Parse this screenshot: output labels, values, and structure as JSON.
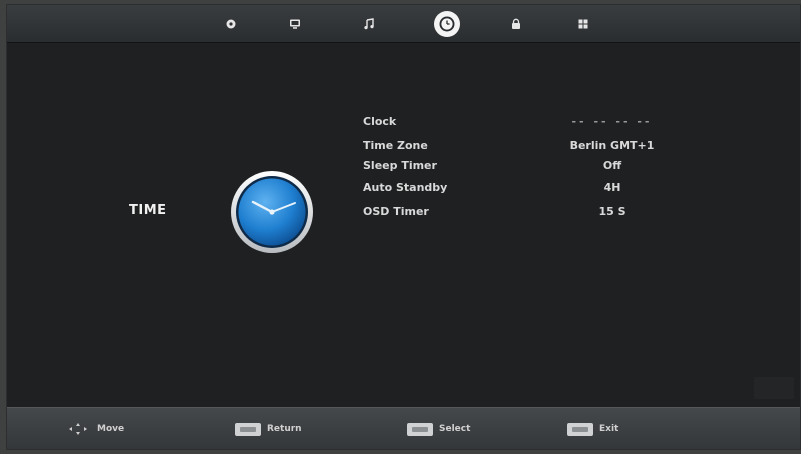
{
  "tabs": [
    {
      "icon": "picture-icon",
      "active": false
    },
    {
      "icon": "tv-icon",
      "active": false
    },
    {
      "icon": "music-note-icon",
      "active": false
    },
    {
      "icon": "clock-icon",
      "active": true
    },
    {
      "icon": "lock-icon",
      "active": false
    },
    {
      "icon": "grid-icon",
      "active": false
    }
  ],
  "section": {
    "title": "TIME",
    "icon": "clock-icon"
  },
  "menu": [
    {
      "label": "Clock",
      "value": "-- -- -- --"
    },
    {
      "label": "Time Zone",
      "value": "Berlin GMT+1"
    },
    {
      "label": "Sleep Timer",
      "value": "Off"
    },
    {
      "label": "Auto Standby",
      "value": "4H"
    },
    {
      "label": "OSD Timer",
      "value": "15 S"
    }
  ],
  "footer": [
    {
      "icon": "navigation-arrows-icon",
      "label": "Move"
    },
    {
      "icon": "menu-key-icon",
      "label": "Return"
    },
    {
      "icon": "enter-key-icon",
      "label": "Select"
    },
    {
      "icon": "exit-key-icon",
      "label": "Exit"
    }
  ],
  "colors": {
    "background": "#1e2022",
    "bar": "#3a3d40",
    "text": "#f1f1f1",
    "clock_blue": "#1f7fd0",
    "clock_ring": "#e8e8e8"
  }
}
